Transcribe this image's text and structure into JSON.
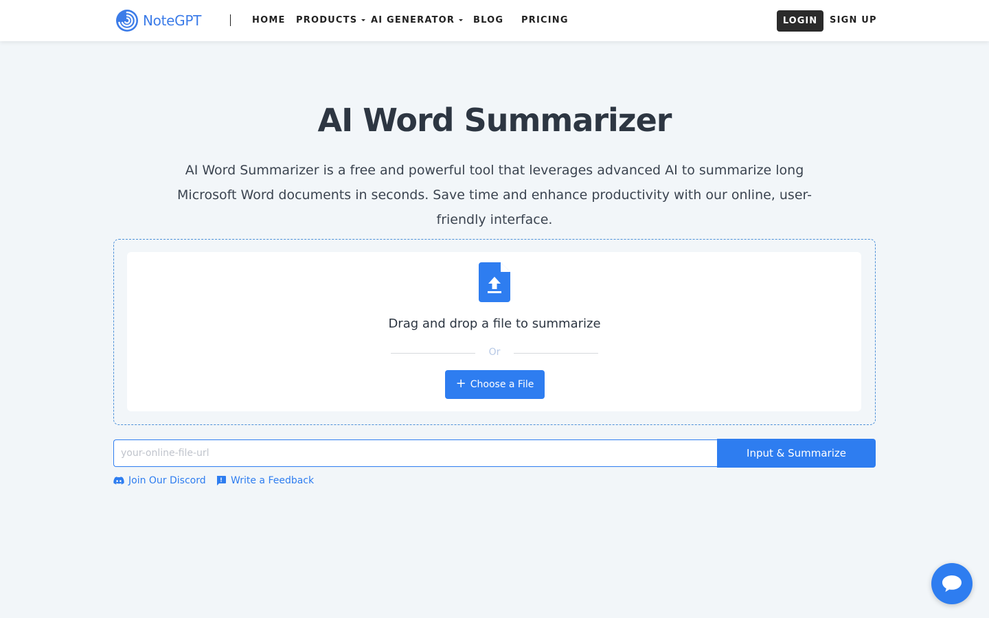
{
  "brand": {
    "name": "NoteGPT",
    "color": "#3c7ce8"
  },
  "nav": {
    "items": [
      {
        "label": "HOME",
        "dropdown": false
      },
      {
        "label": "PRODUCTS",
        "dropdown": true
      },
      {
        "label": "AI GENERATOR",
        "dropdown": true
      },
      {
        "label": "BLOG",
        "dropdown": false
      },
      {
        "label": "PRICING",
        "dropdown": false
      }
    ],
    "login_label": "LOGIN",
    "signup_label": "SIGN UP"
  },
  "hero": {
    "title": "AI Word Summarizer",
    "subtitle": "AI Word Summarizer is a free and powerful tool that leverages advanced AI to summarize long Microsoft Word documents in seconds. Save time and enhance productivity with our online, user-friendly interface."
  },
  "upload": {
    "icon": "file-upload-icon",
    "drag_text": "Drag and drop a file to summarize",
    "or_text": "Or",
    "choose_label": "Choose a File"
  },
  "url_form": {
    "placeholder": "your-online-file-url",
    "value": "",
    "submit_label": "Input & Summarize"
  },
  "links": {
    "discord_label": "Join Our Discord",
    "feedback_label": "Write a Feedback"
  },
  "chat": {
    "icon": "chat-bubble-icon"
  },
  "colors": {
    "accent": "#2e7df0",
    "background": "#f2f6f9",
    "dark_button": "#2b2b2b"
  }
}
